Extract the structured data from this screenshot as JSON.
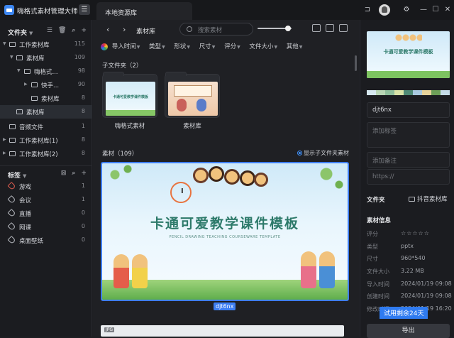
{
  "app": {
    "title": "嗨格式素材管理大师",
    "tab": "本地资源库"
  },
  "sidebar": {
    "folders_title": "文件夹",
    "tree": [
      {
        "label": "工作素材库",
        "count": "115"
      },
      {
        "label": "素材库",
        "count": "109"
      },
      {
        "label": "嗨格式...",
        "count": "98"
      },
      {
        "label": "快手...",
        "count": "90"
      },
      {
        "label": "素材库",
        "count": "8"
      },
      {
        "label": "素材库",
        "count": "8"
      },
      {
        "label": "音频文件",
        "count": "1"
      },
      {
        "label": "工作素材库(1)",
        "count": "8"
      },
      {
        "label": "工作素材库(2)",
        "count": "8"
      }
    ],
    "tags_title": "标签",
    "tags": [
      {
        "label": "游戏",
        "count": "1"
      },
      {
        "label": "会议",
        "count": "1"
      },
      {
        "label": "直播",
        "count": "0"
      },
      {
        "label": "网课",
        "count": "0"
      },
      {
        "label": "桌面壁纸",
        "count": "0"
      }
    ]
  },
  "toolbar": {
    "back": "‹",
    "forward": "›",
    "breadcrumb": "素材库",
    "search_placeholder": "搜索素材",
    "zoom_level": 0.9
  },
  "filters": [
    "导入时间",
    "类型",
    "形状",
    "尺寸",
    "评分",
    "文件大小",
    "其他"
  ],
  "subfolders": {
    "heading": "子文件夹（2）",
    "items": [
      {
        "name": "嗨格式素材"
      },
      {
        "name": "素材库"
      }
    ]
  },
  "materials": {
    "heading": "素材（109）",
    "show_sub": "显示子文件夹素材",
    "selected": {
      "title": "卡通可爱教学课件模板",
      "subtitle": "PENCIL DRAWING TEACHING COURSEWARE TEMPLATE",
      "filename": "djt6nx"
    },
    "next_badge": "JPG"
  },
  "detail": {
    "preview_title": "卡通可爱教学课件模板",
    "swatches": [
      "#d6e8ef",
      "#b9d6b5",
      "#8fbf9c",
      "#d9e3a8",
      "#4f8a76",
      "#a9c9e0",
      "#e7d39b",
      "#6d9f58",
      "#c5dbe7"
    ],
    "name": "djt6nx",
    "tag_placeholder": "添加标签",
    "note_placeholder": "添加备注",
    "url_placeholder": "https://",
    "folder_label": "文件夹",
    "folder_value": "抖音素材库",
    "info_title": "素材信息",
    "info": [
      {
        "k": "评分",
        "v": "☆☆☆☆☆"
      },
      {
        "k": "类型",
        "v": "pptx"
      },
      {
        "k": "尺寸",
        "v": "960*540"
      },
      {
        "k": "文件大小",
        "v": "3.22 MB"
      },
      {
        "k": "导入时间",
        "v": "2024/01/19 09:08"
      },
      {
        "k": "创建时间",
        "v": "2024/01/19 09:08"
      },
      {
        "k": "修改时间",
        "v": "2024/01/19 16:20"
      }
    ],
    "trial": "试用剩余24天",
    "export": "导出"
  }
}
